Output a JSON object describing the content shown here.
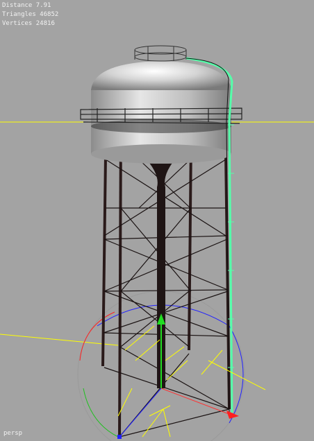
{
  "viewport": {
    "camera": "persp",
    "hud": {
      "distance": "Distance 7.91",
      "triangles": "Triangles 46852",
      "vertices": "Vertices 24816"
    }
  },
  "colors": {
    "background": "#a3a3a3",
    "grid_axis": "#ffff00",
    "selection": "#55ffaa",
    "gizmo_x": "#ff2020",
    "gizmo_y": "#20c020",
    "gizmo_z": "#2020ff",
    "manip_arrow": "#22dd22"
  },
  "scene": {
    "object": "water-tower",
    "manipulator": "move-tool"
  }
}
